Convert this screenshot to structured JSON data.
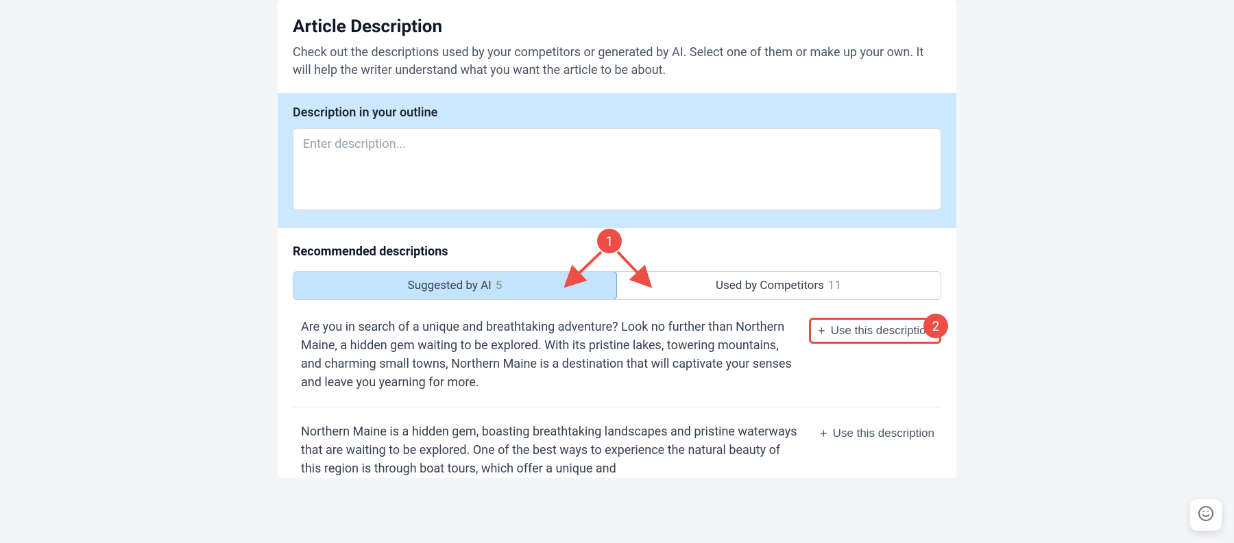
{
  "header": {
    "title": "Article Description",
    "subtitle": "Check out the descriptions used by your competitors or generated by AI. Select one of them or make up your own. It will help the writer understand what you want the article to be about."
  },
  "outline": {
    "label": "Description in your outline",
    "placeholder": "Enter description...",
    "value": ""
  },
  "recommended": {
    "title": "Recommended descriptions",
    "tabs": {
      "ai": {
        "label": "Suggested by AI",
        "count": "5"
      },
      "competitors": {
        "label": "Used by Competitors",
        "count": "11"
      }
    },
    "use_label": "Use this description",
    "items": [
      {
        "text": "Are you in search of a unique and breathtaking adventure? Look no further than Northern Maine, a hidden gem waiting to be explored. With its pristine lakes, towering mountains, and charming small towns, Northern Maine is a destination that will captivate your senses and leave you yearning for more."
      },
      {
        "text": "Northern Maine is a hidden gem, boasting breathtaking landscapes and pristine waterways that are waiting to be explored. One of the best ways to experience the natural beauty of this region is through boat tours, which offer a unique and"
      }
    ]
  },
  "annotations": {
    "badge1": "1",
    "badge2": "2"
  }
}
